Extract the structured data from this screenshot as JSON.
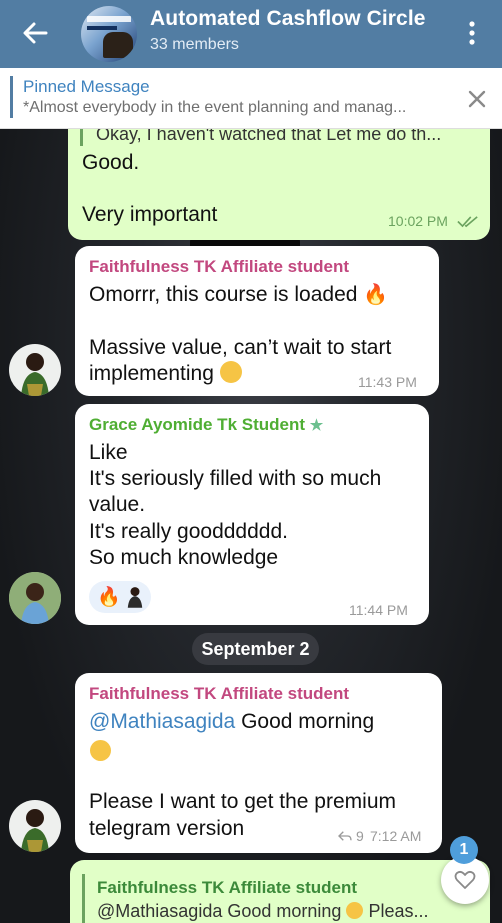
{
  "header": {
    "title": "Automated Cashflow Circle",
    "members": "33 members"
  },
  "pinned": {
    "title": "Pinned Message",
    "text": "*Almost everybody in the event planning and manag..."
  },
  "messages": {
    "m1": {
      "quote": "Okay, I haven't watched that  Let me do th...",
      "line1": "Good.",
      "line2": "Very important",
      "time": "10:02 PM"
    },
    "m2": {
      "sender": "Faithfulness TK Affiliate student",
      "line1": "Omorrr, this course is loaded",
      "line2": "Massive value, can’t wait to start",
      "line3": "implementing",
      "time": "11:43 PM"
    },
    "m3": {
      "sender": "Grace Ayomide Tk Student",
      "line1": "Like",
      "line2": "It's seriously filled with so much",
      "line3": "value.",
      "line4": "It's really goodddddd.",
      "line5": "So much knowledge",
      "time": "11:44 PM"
    },
    "date_separator": "September 2",
    "m4": {
      "sender": "Faithfulness TK Affiliate student",
      "mention": "@Mathiasagida",
      "line1_rest": " Good morning",
      "line2": "Please I want to get the premium",
      "line3": "telegram version",
      "replies": "9",
      "time": "7:12 AM"
    },
    "m5": {
      "sender": "Faithfulness TK Affiliate student",
      "preview_start": "@Mathiasagida Good morning",
      "preview_end": "Pleas..."
    }
  },
  "fab": {
    "badge": "1"
  },
  "colors": {
    "header": "#527da3",
    "outgoing_bubble": "#e1ffc7",
    "faithfulness_name": "#c2487f",
    "grace_name": "#4fae33",
    "link": "#3f83bf"
  }
}
